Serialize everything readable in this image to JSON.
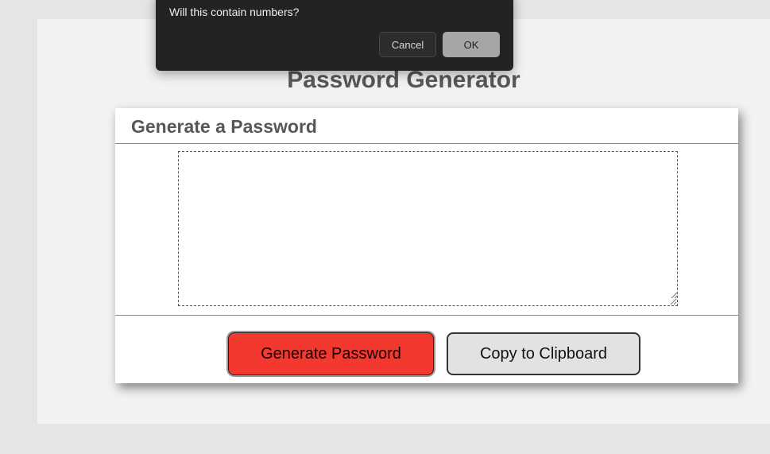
{
  "page": {
    "title": "Password Generator"
  },
  "card": {
    "title": "Generate a Password",
    "password_value": "",
    "generate_label": "Generate Password",
    "copy_label": "Copy to Clipboard"
  },
  "dialog": {
    "message": "Will this contain numbers?",
    "cancel_label": "Cancel",
    "ok_label": "OK"
  },
  "colors": {
    "generate_button": "#f3382f",
    "copy_button": "#e2e2e2",
    "dialog_background": "#232323",
    "ok_button": "#a6a6a6"
  }
}
